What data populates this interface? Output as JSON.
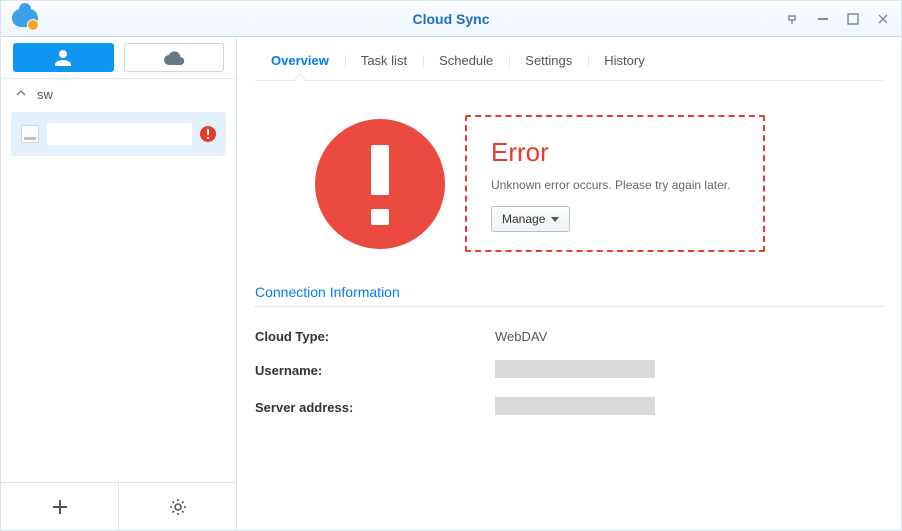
{
  "window": {
    "title": "Cloud Sync"
  },
  "sidebar": {
    "group_label": "sw"
  },
  "tabs": [
    {
      "id": "overview",
      "label": "Overview",
      "active": true
    },
    {
      "id": "tasklist",
      "label": "Task list",
      "active": false
    },
    {
      "id": "schedule",
      "label": "Schedule",
      "active": false
    },
    {
      "id": "settings",
      "label": "Settings",
      "active": false
    },
    {
      "id": "history",
      "label": "History",
      "active": false
    }
  ],
  "error_panel": {
    "title": "Error",
    "message": "Unknown error occurs. Please try again later.",
    "manage_label": "Manage"
  },
  "connection": {
    "section_title": "Connection Information",
    "rows": {
      "cloud_type": {
        "label": "Cloud Type:",
        "value": "WebDAV"
      },
      "username": {
        "label": "Username:",
        "value": ""
      },
      "server": {
        "label": "Server address:",
        "value": ""
      }
    }
  }
}
